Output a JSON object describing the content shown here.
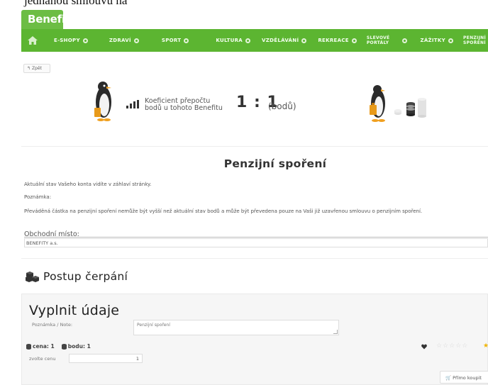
{
  "page": {
    "top_fragment": "jednanou smlouvu na"
  },
  "brand": {
    "logo_text": "Benefity",
    "accent": "#5cb531"
  },
  "nav": {
    "items": [
      {
        "label": "E-SHOPY"
      },
      {
        "label": "ZDRAVÍ"
      },
      {
        "label": "SPORT"
      },
      {
        "label": "KULTURA"
      },
      {
        "label": "VZDĚLÁVÁNÍ"
      },
      {
        "label": "REKREACE"
      },
      {
        "label_line1": "SLEVOVÉ",
        "label_line2": "PORTÁLY"
      },
      {
        "label": "ZÁŽITKY"
      },
      {
        "label_line1": "PENZIJNÍ",
        "label_line2": "SPOŘENÍ"
      }
    ]
  },
  "back_button": {
    "label": "Zpět"
  },
  "coefficient": {
    "label_line1": "Koeficient přepočtu",
    "label_line2": "bodů u tohoto Benefitu",
    "ratio": "1 : 1",
    "unit": "(bodů)"
  },
  "main": {
    "title": "Penzijní spoření",
    "status_text": "Aktuální stav Vašeho konta vidíte v záhlaví stránky.",
    "note_label": "Poznámka:",
    "note_text": "Převáděná částka na penzijní spoření nemůže být vyšší než aktuální stav bodů a může být převedena pouze na Vaši již uzavřenou smlouvu o penzijním spoření.",
    "obchodni_label": "Obchodní místo:",
    "obchodni_value": "BENEFITY a.s."
  },
  "postup": {
    "title": "Postup čerpání"
  },
  "form": {
    "title": "Vyplnit údaje",
    "note_label": "Poznámka / Note:",
    "note_value": "Penzijní spoření",
    "price_label": "cena: 1",
    "points_label": "bodu: 1",
    "choose_price_label": "zvolte cenu",
    "choose_price_value": "1",
    "buy_label": "Přímo koupit",
    "stars_empty": "☆☆☆☆☆",
    "star_filled": "★"
  }
}
